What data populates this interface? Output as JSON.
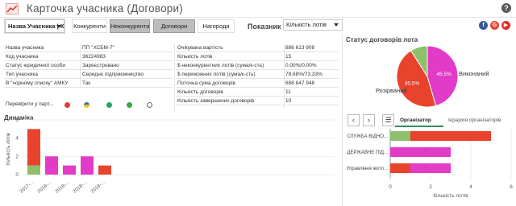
{
  "header": {
    "title": "Карточка учасника (Договори)",
    "help": "?"
  },
  "filters": {
    "participant_dropdown": "Назва Учасника | К...",
    "competitors": "Конкуренти",
    "non_competitors": "Неконкуренти",
    "contracts": "Договори",
    "awards": "Нагороди"
  },
  "indicator": {
    "label": "Показник",
    "value": "Кількість лотів"
  },
  "social": {
    "fb": "f",
    "gp": "G",
    "yt": "▶"
  },
  "info_left": [
    {
      "label": "Назва учасника",
      "value": "ПП \"ХСБМ-7\""
    },
    {
      "label": "Код учасника",
      "value": "36224983"
    },
    {
      "label": "Статус юридичної особи",
      "value": "Зареєстровано"
    },
    {
      "label": "Тип учасника",
      "value": "Середнє підприємництво"
    },
    {
      "label": "В \"чорному списку\" АМКУ",
      "value": "Так"
    }
  ],
  "info_right": [
    {
      "label": "Очікувана вартість",
      "value": "886 613 908"
    },
    {
      "label": "Кількість лотів",
      "value": "15"
    },
    {
      "label": "$ неконкурентних лотів (сума/к-сть)",
      "value": "0,00%/0,00%"
    },
    {
      "label": "$ переможних лотів (сума/к-сть)",
      "value": "78,68%/73,33%"
    },
    {
      "label": "Поточна сума договорів",
      "value": "688 847 948"
    },
    {
      "label": "Кількість договорів",
      "value": "11"
    },
    {
      "label": "Кількість завершених договорів",
      "value": "10"
    }
  ],
  "check_label": "Перевірити у парт...",
  "dynamics": {
    "title": "Динаміка"
  },
  "status_pie": {
    "title": "Статус договорів лота",
    "labels_shown": [
      "Виконаний",
      "Розірваний"
    ],
    "colors": [
      "#e23bc7",
      "#e8432c",
      "#8dc06b"
    ]
  },
  "org": {
    "tab1": "Організатор",
    "tab2": "Ієрархія організаторів",
    "prev": "‹",
    "next": "›",
    "list": "☰"
  },
  "chart_data": [
    {
      "type": "bar",
      "title": "Динаміка",
      "ylabel": "Кількість лотів",
      "ylim": [
        0,
        6
      ],
      "yticks": [
        0,
        2,
        4,
        6
      ],
      "categories": [
        "2017-...",
        "2018-...",
        "2018-...",
        "2018-...",
        "2018-..."
      ],
      "series": [
        {
          "name": "",
          "color": "#8dc06b",
          "values": [
            1,
            0,
            0,
            0,
            0
          ]
        },
        {
          "name": "",
          "color": "#e8432c",
          "values": [
            4,
            0,
            0,
            0,
            1
          ]
        },
        {
          "name": "",
          "color": "#e23bc7",
          "values": [
            0,
            2,
            1,
            2,
            0
          ]
        }
      ],
      "stacked": true
    },
    {
      "type": "pie",
      "title": "Статус договорів лота",
      "slices": [
        {
          "label": "Виконаний",
          "value": 45.5,
          "color": "#e23bc7"
        },
        {
          "label": "Розірваний",
          "value": 45.5,
          "color": "#e8432c"
        },
        {
          "label": "",
          "value": 9.0,
          "color": "#8dc06b"
        }
      ],
      "data_labels": [
        "45.5%",
        "45.5%"
      ]
    },
    {
      "type": "bar",
      "orientation": "horizontal",
      "xlabel": "Кількість лотів",
      "xlim": [
        0,
        6
      ],
      "xticks": [
        0,
        2,
        4,
        6
      ],
      "categories": [
        "СЛУЖБА ВІДНО...",
        "ДЕРЖАВНЕ ПІД...",
        "Управління житл..."
      ],
      "series": [
        {
          "name": "",
          "color": "#8dc06b",
          "values": [
            1,
            0,
            0
          ]
        },
        {
          "name": "",
          "color": "#e8432c",
          "values": [
            4,
            0,
            1
          ]
        },
        {
          "name": "",
          "color": "#e23bc7",
          "values": [
            0,
            3,
            2
          ]
        }
      ],
      "stacked": true
    }
  ]
}
